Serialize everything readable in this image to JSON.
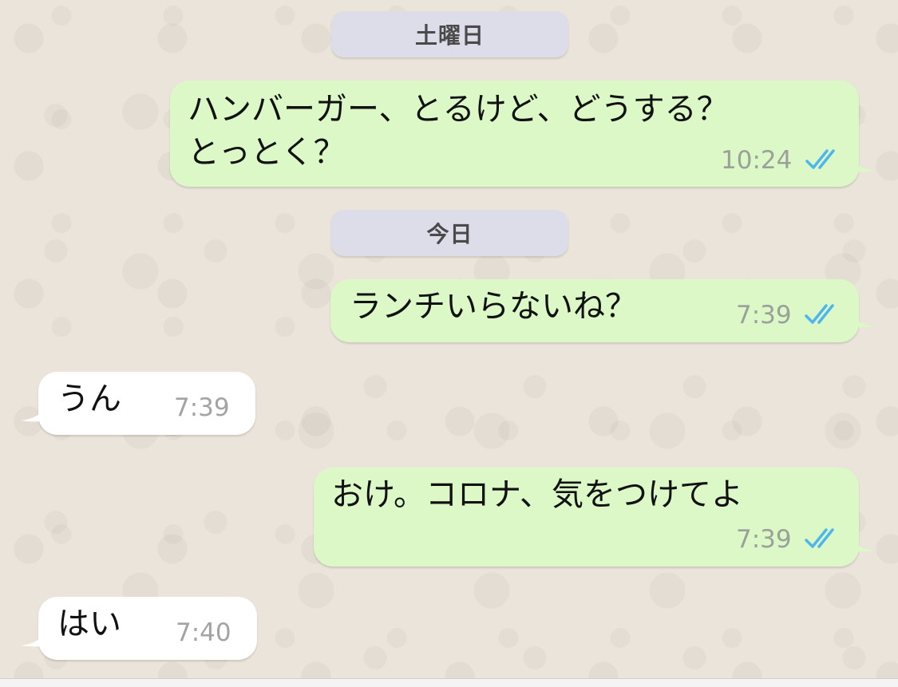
{
  "date_separators": {
    "saturday": "土曜日",
    "today": "今日"
  },
  "messages": [
    {
      "direction": "outgoing",
      "lines": [
        "ハンバーガー、とるけど、どうする？",
        "とっとく？"
      ],
      "time": "10:24",
      "status": "read-double-tick-icon"
    },
    {
      "direction": "outgoing",
      "lines": [
        "ランチいらないね？"
      ],
      "time": "7:39",
      "status": "read-double-tick-icon"
    },
    {
      "direction": "incoming",
      "lines": [
        "うん"
      ],
      "time": "7:39"
    },
    {
      "direction": "outgoing",
      "lines": [
        "おけ。コロナ、気をつけてよ"
      ],
      "time": "7:39",
      "status": "read-double-tick-icon"
    },
    {
      "direction": "incoming",
      "lines": [
        "はい"
      ],
      "time": "7:40"
    }
  ],
  "colors": {
    "outgoing_bubble": "#dcf8c6",
    "incoming_bubble": "#ffffff",
    "read_tick": "#4fb6ec",
    "wallpaper": "#ece5dd"
  }
}
